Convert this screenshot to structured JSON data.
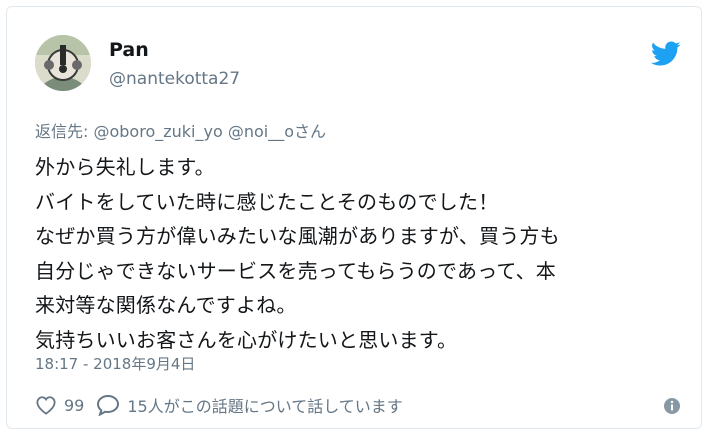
{
  "user": {
    "display_name": "Pan",
    "handle": "@nantekotta27"
  },
  "tweet": {
    "reply_prefix": "返信先: ",
    "reply_mentions": "@oboro_zuki_yo @noi__o",
    "reply_suffix": "さん",
    "lines": [
      "外から失礼します。",
      "バイトをしていた時に感じたことそのものでした！",
      "なぜか買う方が偉いみたいな風潮がありますが、買う方も",
      "自分じゃできないサービスを売ってもらうのであって、本",
      "来対等な関係なんですよね。",
      "気持ちいいお客さんを心がけたいと思います。"
    ],
    "timestamp": "18:17 - 2018年9月4日"
  },
  "actions": {
    "like_count": "99",
    "reply_text": "15人がこの話題について話しています"
  },
  "icons": {
    "brand": "twitter-bird-icon",
    "like": "heart-icon",
    "reply": "speech-bubble-icon",
    "info": "info-icon"
  },
  "colors": {
    "twitter_blue": "#1da1f2",
    "muted_text": "#657786",
    "main_text": "#14171a"
  }
}
